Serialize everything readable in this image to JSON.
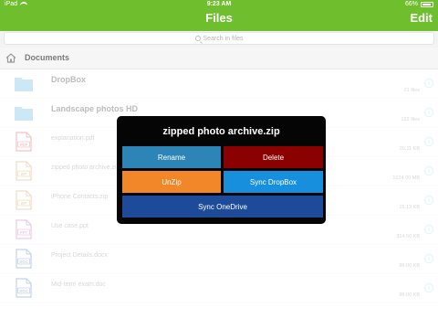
{
  "status": {
    "time": "9:23 AM",
    "carrier": "iPad",
    "battery": "66%"
  },
  "nav": {
    "title": "Files",
    "edit_label": "Edit"
  },
  "search": {
    "placeholder": "Search in files"
  },
  "breadcrumb": {
    "label": "Documents"
  },
  "list": [
    {
      "kind": "folder",
      "name": "DropBox",
      "size": "21 files"
    },
    {
      "kind": "folder",
      "name": "Landscape photos HD",
      "size": "122 files"
    },
    {
      "kind": "file",
      "type": "PDF",
      "name": "explanation.pdf",
      "size": "20.11 KB"
    },
    {
      "kind": "file",
      "type": "ZIP",
      "name": "zipped photo archive.zip",
      "size": "1024.00 MB"
    },
    {
      "kind": "file",
      "type": "ZIP",
      "name": "iPhone Contacts.zip",
      "size": "15.13 KB"
    },
    {
      "kind": "file",
      "type": "PPT",
      "name": "Use case.ppt",
      "size": "314.50 KB"
    },
    {
      "kind": "file",
      "type": "DOC",
      "name": "Project Details.docx",
      "size": "96.00 KB"
    },
    {
      "kind": "file",
      "type": "DOC",
      "name": "Mid-term exam.doc",
      "size": "96.00 KB"
    }
  ],
  "popup": {
    "title": "zipped photo archive.zip",
    "rename": "Rename",
    "delete": "Delete",
    "unzip": "UnZip",
    "sync_dropbox": "Sync DropBox",
    "sync_onedrive": "Sync OneDrive"
  },
  "colors": {
    "brand": "#6fbe2d",
    "folder": "#8ecae8",
    "pdf": "#e5798a",
    "zip": "#e3b47a",
    "ppt": "#d58bd0",
    "doc": "#7d9bd6"
  }
}
